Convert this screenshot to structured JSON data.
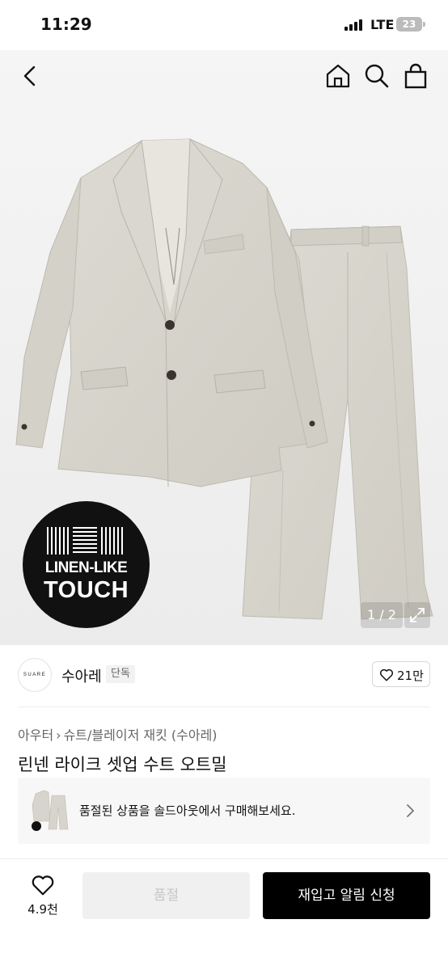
{
  "status_bar": {
    "time": "11:29",
    "network": "LTE",
    "battery": "23"
  },
  "top_nav": {
    "icons": [
      "back-icon",
      "home-icon",
      "search-icon",
      "shopping-bag-icon"
    ]
  },
  "hero": {
    "badge_line1": "LINEN-LIKE",
    "badge_line2": "TOUCH",
    "pager": "1 / 2",
    "colors": {
      "fabric": "#d6d4cc",
      "badge": "#111111"
    }
  },
  "brand": {
    "logo_text": "SUARE",
    "name": "수아레",
    "exclusive": "단독",
    "likes": "21만"
  },
  "breadcrumb": {
    "category1": "아우터",
    "category2": "슈트/블레이저 재킷 (수아레)"
  },
  "product": {
    "title": "린넨 라이크 셋업 수트 오트밀"
  },
  "soldout_banner": {
    "text": "품절된 상품을 솔드아웃에서 구매해보세요."
  },
  "bottom_bar": {
    "wish_count": "4.9천",
    "soldout_label": "품절",
    "restock_label": "재입고 알림 신청"
  }
}
